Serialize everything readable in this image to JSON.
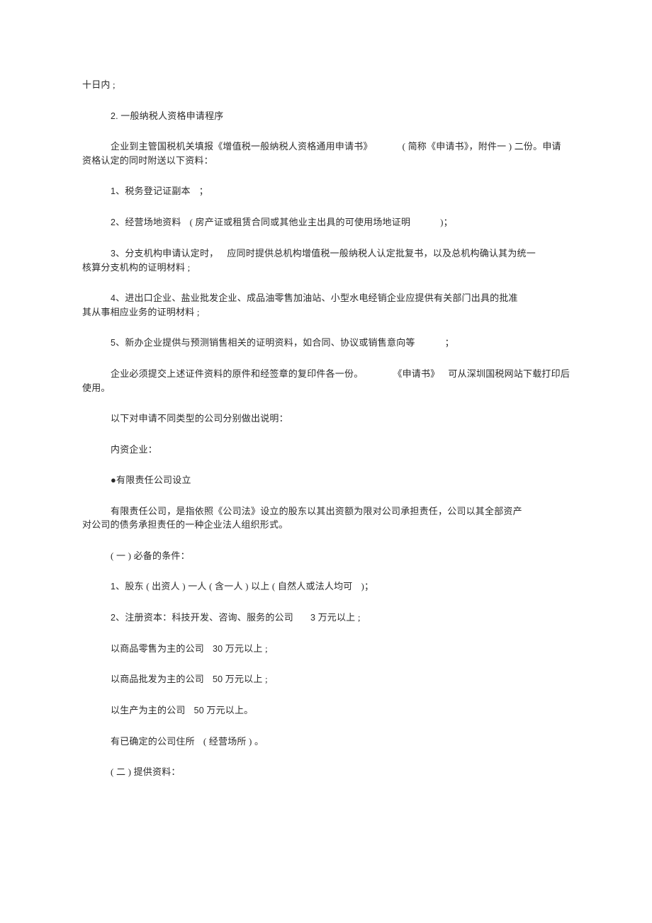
{
  "paragraphs": {
    "p0": "十日内 ;",
    "p1_a": "2.",
    "p1_b": " 一般纳税人资格申请程序",
    "p2_a": "企业到主管国税机关填报《增值税一般纳税人资格通用申请书》",
    "p2_b": "( 简称《申请书》，附件一 ) 二份。申请",
    "p2_c": "资格认定的同时附送以下资料：",
    "p3_a": "1",
    "p3_b": "、税务登记证副本",
    "p3_c": "；",
    "p4_a": "2",
    "p4_b": "、经营场地资料",
    "p4_c": "( 房产证或租赁合同或其他业主出具的可使用场地证明",
    "p4_d": ")；",
    "p5_a": "3",
    "p5_b": "、分支机构申请认定时，",
    "p5_c": "应同时提供总机构增值税一般纳税人认定批复书，以及总机构确认其为统一",
    "p5_d": "核算分支机构的证明材料 ;",
    "p6_a": "4",
    "p6_b": "、进出口企业、盐业批发企业、成品油零售加油站、小型水电经销企业应提供有关部门出具的批准",
    "p6_c": "其从事相应业务的证明材料 ;",
    "p7_a": "5",
    "p7_b": "、新办企业提供与预测销售相关的证明资料，如合同、协议或销售意向等",
    "p7_c": "；",
    "p8_a": "企业必须提交上述证件资料的原件和经签章的复印件各一份。",
    "p8_b": "《申请书》",
    "p8_c": "可从深圳国税网站下载打印后",
    "p8_d": "使用。",
    "p9": "以下对申请不同类型的公司分别做出说明：",
    "p10": "内资企业：",
    "p11": "●有限责任公司设立",
    "p12_a": "有限责任公司，是指依照《公司法》设立的股东以其出资额为限对公司承担责任，公司以其全部资产",
    "p12_b": "对公司的债务承担责任的一种企业法人组织形式。",
    "p13": "( 一 ) 必备的条件：",
    "p14_a": "1",
    "p14_b": "、股东 ( 出资人 ) 一人 ( 含一人 ) 以上 ( 自然人或法人均可",
    "p14_c": ")；",
    "p15_a": "2",
    "p15_b": "、注册资本：科技开发、咨询、服务的公司",
    "p15_c": "3",
    "p15_d": " 万元以上 ;",
    "p16_a": "以商品零售为主的公司",
    "p16_b": "30",
    "p16_c": " 万元以上 ;",
    "p17_a": "以商品批发为主的公司",
    "p17_b": "50",
    "p17_c": " 万元以上 ;",
    "p18_a": "以生产为主的公司",
    "p18_b": "50",
    "p18_c": " 万元以上。",
    "p19_a": "有已确定的公司住所",
    "p19_b": "( 经营场所 ) 。",
    "p20": "( 二 ) 提供资料："
  }
}
